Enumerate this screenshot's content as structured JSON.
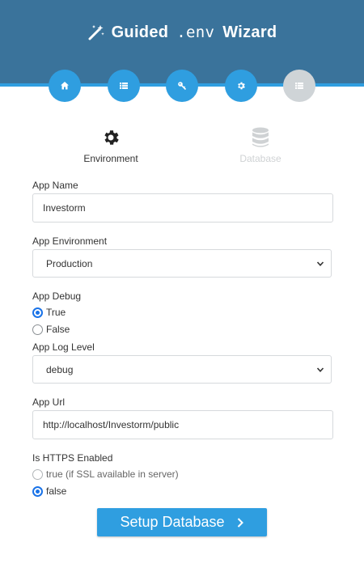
{
  "header": {
    "title_left": "Guided",
    "title_mono": ".env",
    "title_right": "Wizard",
    "icon": "magic-wand-icon",
    "background": "#3a739b",
    "accent": "#2f9ee0"
  },
  "steps": [
    {
      "icon": "home-icon",
      "active": true
    },
    {
      "icon": "list-icon",
      "active": true
    },
    {
      "icon": "key-icon",
      "active": true
    },
    {
      "icon": "gear-icon",
      "active": true
    },
    {
      "icon": "table-icon",
      "active": false
    }
  ],
  "tabs": {
    "environment": {
      "label": "Environment",
      "icon": "gear-icon"
    },
    "database": {
      "label": "Database",
      "icon": "database-icon"
    }
  },
  "form": {
    "app_name": {
      "label": "App Name",
      "value": "Investorm"
    },
    "app_environment": {
      "label": "App Environment",
      "selected": "Production"
    },
    "app_debug": {
      "label": "App Debug",
      "options": [
        "True",
        "False"
      ],
      "selected": "True"
    },
    "app_log_level": {
      "label": "App Log Level",
      "selected": "debug"
    },
    "app_url": {
      "label": "App Url",
      "value": "http://localhost/Investorm/public"
    },
    "https_enabled": {
      "label": "Is HTTPS Enabled",
      "options": [
        "true (if SSL available in server)",
        "false"
      ],
      "selected": "false"
    }
  },
  "submit_label": "Setup Database"
}
